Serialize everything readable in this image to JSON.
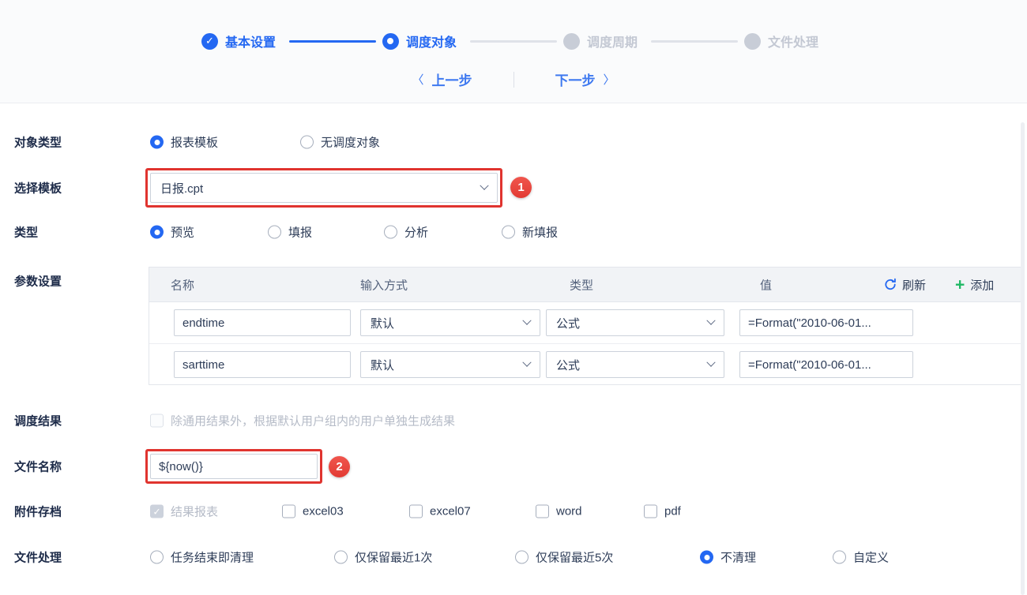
{
  "stepper": {
    "steps": [
      {
        "label": "基本设置",
        "state": "done",
        "icon": "check-circle-icon"
      },
      {
        "label": "调度对象",
        "state": "current",
        "icon": "dot-circle-icon"
      },
      {
        "label": "调度周期",
        "state": "pending",
        "icon": "circle-icon"
      },
      {
        "label": "文件处理",
        "state": "pending",
        "icon": "circle-icon"
      }
    ],
    "check_glyph": "✓"
  },
  "nav": {
    "prev_arrow": "〈",
    "prev_label": "上一步",
    "next_label": "下一步",
    "next_arrow": "〉"
  },
  "annotations": {
    "badge1": "1",
    "badge2": "2",
    "box_color": "#e0342f"
  },
  "form": {
    "object_type": {
      "label": "对象类型",
      "options": [
        {
          "label": "报表模板",
          "selected": true
        },
        {
          "label": "无调度对象",
          "selected": false
        }
      ]
    },
    "template": {
      "label": "选择模板",
      "value": "日报.cpt"
    },
    "view_type": {
      "label": "类型",
      "options": [
        {
          "label": "预览",
          "selected": true
        },
        {
          "label": "填报",
          "selected": false
        },
        {
          "label": "分析",
          "selected": false
        },
        {
          "label": "新填报",
          "selected": false
        }
      ]
    },
    "params": {
      "label": "参数设置",
      "headers": [
        "名称",
        "输入方式",
        "类型",
        "值"
      ],
      "refresh_label": "刷新",
      "add_label": "添加",
      "rows": [
        {
          "name": "endtime",
          "input_mode": "默认",
          "type": "公式",
          "value": "=Format(\"2010-06-01..."
        },
        {
          "name": "sarttime",
          "input_mode": "默认",
          "type": "公式",
          "value": "=Format(\"2010-06-01..."
        }
      ]
    },
    "schedule_result": {
      "label": "调度结果",
      "checkbox_label": "除通用结果外，根据默认用户组内的用户单独生成结果",
      "checked": false,
      "disabled": true
    },
    "file_name": {
      "label": "文件名称",
      "value": "${now()}"
    },
    "attachments": {
      "label": "附件存档",
      "options": [
        {
          "label": "结果报表",
          "checked": true,
          "disabled": true
        },
        {
          "label": "excel03",
          "checked": false,
          "disabled": false
        },
        {
          "label": "excel07",
          "checked": false,
          "disabled": false
        },
        {
          "label": "word",
          "checked": false,
          "disabled": false
        },
        {
          "label": "pdf",
          "checked": false,
          "disabled": false
        }
      ],
      "check_glyph": "✓"
    },
    "file_handling": {
      "label": "文件处理",
      "options": [
        {
          "label": "任务结束即清理",
          "selected": false
        },
        {
          "label": "仅保留最近1次",
          "selected": false
        },
        {
          "label": "仅保留最近5次",
          "selected": false
        },
        {
          "label": "不清理",
          "selected": true
        },
        {
          "label": "自定义",
          "selected": false
        }
      ]
    }
  },
  "colors": {
    "accent_blue": "#2468f2",
    "annotation_red": "#e0342f",
    "add_green": "#1fb864",
    "pending_gray": "#c8cdd7"
  }
}
